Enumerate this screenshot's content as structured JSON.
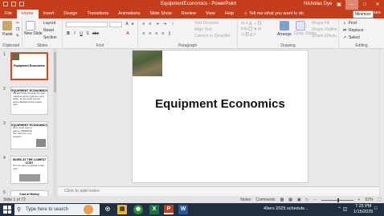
{
  "titlebar": {
    "doc_title": "EquipmentEconomics - PowerPoint",
    "user": "Nicholas Dye",
    "tooltip": "Minimize",
    "min": "—",
    "max": "□",
    "close": "✕",
    "restore": "▣"
  },
  "tabs": [
    {
      "label": "File"
    },
    {
      "label": "Home"
    },
    {
      "label": "Insert"
    },
    {
      "label": "Design"
    },
    {
      "label": "Transitions"
    },
    {
      "label": "Animations"
    },
    {
      "label": "Slide Show"
    },
    {
      "label": "Review"
    },
    {
      "label": "View"
    },
    {
      "label": "Help"
    }
  ],
  "tell_me": "Tell me what you want to do",
  "share": "Share",
  "ribbon": {
    "clipboard": {
      "label": "Clipboard",
      "paste": "Paste"
    },
    "slides": {
      "label": "Slides",
      "new_slide": "New Slide",
      "layout": "Layout",
      "reset": "Reset",
      "section": "Section"
    },
    "font": {
      "label": "Font",
      "bold": "B",
      "italic": "I",
      "underline": "U",
      "shadow": "S",
      "strike": "abc",
      "font_color": "A"
    },
    "paragraph": {
      "label": "Paragraph",
      "text_direction": "Text Direction",
      "align_text": "Align Text",
      "smartart": "Convert to SmartArt"
    },
    "drawing": {
      "label": "Drawing",
      "arrange": "Arrange",
      "quick_styles": "Quick Styles",
      "shape_fill": "Shape Fill",
      "shape_outline": "Shape Outline",
      "shape_effects": "Shape Effects"
    },
    "editing": {
      "label": "Editing",
      "find": "Find",
      "replace": "Replace",
      "select": "Select"
    }
  },
  "thumbnails": [
    {
      "num": "1",
      "title": "Equipment Economics",
      "body": ""
    },
    {
      "num": "2",
      "title": "EQUIPMENT ECONOMICS",
      "body": "OBJECTIVE: Provide the right machine at the right time and place, so the work can be accomplished at the lowest cost"
    },
    {
      "num": "3",
      "title": "EQUIPMENT ECONOMICS",
      "body": "How much does it cost to OPERATE the machine on a project?"
    },
    {
      "num": "4",
      "title": "WORK AT THE LOWEST COST",
      "body": "Put the same to lowest rental cost"
    },
    {
      "num": "5",
      "title": "Cost of Money",
      "body": ""
    }
  ],
  "slide": {
    "title": "Equipment Economics"
  },
  "notes_placeholder": "Click to add notes",
  "status": {
    "slide_of": "Slide 1 of 72",
    "notes": "Notes",
    "comments": "Comments",
    "zoom": "62%"
  },
  "taskbar": {
    "search": "Type here to search",
    "news": "49ers 2025 schedule...",
    "time": "7:25 PM",
    "date": "1/15/2025",
    "apps": [
      {
        "letter": "◎"
      },
      {
        "letter": "▦"
      },
      {
        "letter": "◉"
      },
      {
        "letter": "X"
      },
      {
        "letter": "P"
      },
      {
        "letter": "W"
      }
    ]
  },
  "colors": {
    "accent": "#c43e1c",
    "selected_thumb": "#d24726",
    "taskbar": "#1f2f3f"
  }
}
